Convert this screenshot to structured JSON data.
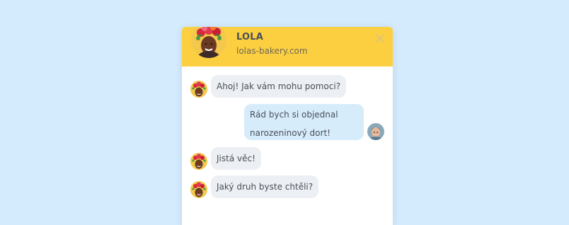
{
  "header": {
    "name": "LOLA",
    "site": "lolas-bakery.com"
  },
  "icons": {
    "close": "close-icon",
    "bot_avatar": "bot-avatar-icon",
    "user_avatar": "user-avatar-icon"
  },
  "colors": {
    "background": "#d4ebfd",
    "header": "#fccf40",
    "bot_bubble": "#eceff3",
    "user_bubble": "#d6ecfb"
  },
  "messages": [
    {
      "sender": "bot",
      "text": "Ahoj! Jak vám mohu pomoci?"
    },
    {
      "sender": "user",
      "text": "Rád bych si objednal narozeninový dort!"
    },
    {
      "sender": "bot",
      "text": "Jistá věc!"
    },
    {
      "sender": "bot",
      "text": "Jaký druh byste chtěli?"
    }
  ]
}
